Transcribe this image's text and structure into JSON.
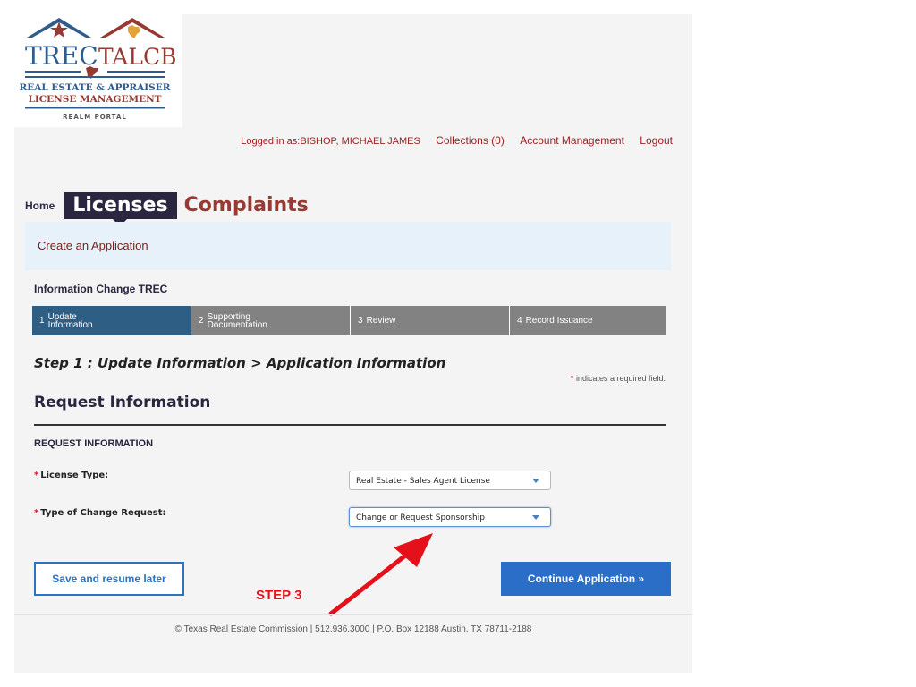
{
  "logo": {
    "line1": "TREC",
    "line2": "TALCB",
    "line3": "REAL ESTATE & APPRAISER",
    "line4": "LICENSE MANAGEMENT",
    "line5": "REALM PORTAL"
  },
  "header": {
    "logged_in": "Logged in as:BISHOP, MICHAEL JAMES",
    "collections": "Collections (0)",
    "account": "Account Management",
    "logout": "Logout"
  },
  "nav": {
    "home": "Home",
    "licenses": "Licenses",
    "complaints": "Complaints"
  },
  "breadcrumb": "Create an Application",
  "application_title": "Information Change TREC",
  "steps": [
    {
      "num": "1",
      "label_line1": "Update",
      "label_line2": "Information",
      "active": true
    },
    {
      "num": "2",
      "label_line1": "Supporting",
      "label_line2": "Documentation",
      "active": false
    },
    {
      "num": "3",
      "label_line1": "Review",
      "label_line2": "",
      "active": false
    },
    {
      "num": "4",
      "label_line1": "Record Issuance",
      "label_line2": "",
      "active": false
    }
  ],
  "step_heading": "Step 1 : Update Information > Application Information",
  "required_note": {
    "star": "*",
    "text": "indicates a required field."
  },
  "section_title": "Request Information",
  "subsection_title": "REQUEST INFORMATION",
  "fields": {
    "license_type": {
      "label": "License Type:",
      "value": "Real Estate - Sales Agent License"
    },
    "change_type": {
      "label": "Type of Change Request:",
      "value": "Change or Request Sponsorship"
    }
  },
  "buttons": {
    "save": "Save and resume later",
    "continue": "Continue Application »"
  },
  "annotation": {
    "label": "STEP 3",
    "color": "#e4111b"
  },
  "footer": "© Texas Real Estate Commission | 512.936.3000 | P.O. Box 12188 Austin, TX 78711-2188",
  "colors": {
    "nav_dark": "#2b2640",
    "brand_red": "#973a33",
    "step_active": "#2f5e84",
    "step_inactive": "#828282",
    "primary_button": "#2a6ec8"
  }
}
